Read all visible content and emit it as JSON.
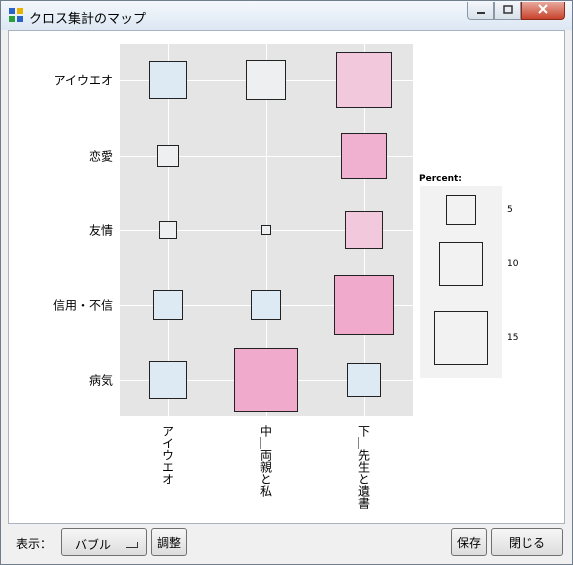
{
  "window": {
    "title": "クロス集計のマップ"
  },
  "chart_data": {
    "type": "bubble-mosaic",
    "rows": [
      "アイウエオ",
      "恋愛",
      "友情",
      "信用・不信",
      "病気"
    ],
    "columns": [
      "アイウエオ",
      "中＿両親と私",
      "下＿先生と遺書"
    ],
    "cells": [
      {
        "row": "アイウエオ",
        "col": "アイウエオ",
        "percent": 7.5,
        "color": "#dde9f3"
      },
      {
        "row": "アイウエオ",
        "col": "中＿両親と私",
        "percent": 8.5,
        "color": "#eeeff1"
      },
      {
        "row": "アイウエオ",
        "col": "下＿先生と遺書",
        "percent": 16,
        "color": "#f2c8dc"
      },
      {
        "row": "恋愛",
        "col": "アイウエオ",
        "percent": 2.5,
        "color": "#eeeff1"
      },
      {
        "row": "恋愛",
        "col": "下＿先生と遺書",
        "percent": 11.5,
        "color": "#f0b0cf"
      },
      {
        "row": "友情",
        "col": "アイウエオ",
        "percent": 1.8,
        "color": "#eeeff1"
      },
      {
        "row": "友情",
        "col": "中＿両親と私",
        "percent": 0.5,
        "color": "#eeeff1"
      },
      {
        "row": "友情",
        "col": "下＿先生と遺書",
        "percent": 7.5,
        "color": "#f2c8dc"
      },
      {
        "row": "信用・不信",
        "col": "アイウエオ",
        "percent": 4.5,
        "color": "#dde9f3"
      },
      {
        "row": "信用・不信",
        "col": "中＿両親と私",
        "percent": 4.5,
        "color": "#dde9f3"
      },
      {
        "row": "信用・不信",
        "col": "下＿先生と遺書",
        "percent": 19,
        "color": "#f0aacb"
      },
      {
        "row": "病気",
        "col": "アイウエオ",
        "percent": 7.5,
        "color": "#dde9f3"
      },
      {
        "row": "病気",
        "col": "中＿両親と私",
        "percent": 22,
        "color": "#f0aacb"
      },
      {
        "row": "病気",
        "col": "下＿先生と遺書",
        "percent": 6,
        "color": "#dde9f3"
      }
    ],
    "legend": {
      "title": "Percent:",
      "sizes": [
        5,
        10,
        15
      ]
    }
  },
  "toolbar": {
    "display_label": "表示：",
    "display_value": "バブル",
    "adjust_label": "調整",
    "save_label": "保存",
    "close_label": "閉じる"
  }
}
